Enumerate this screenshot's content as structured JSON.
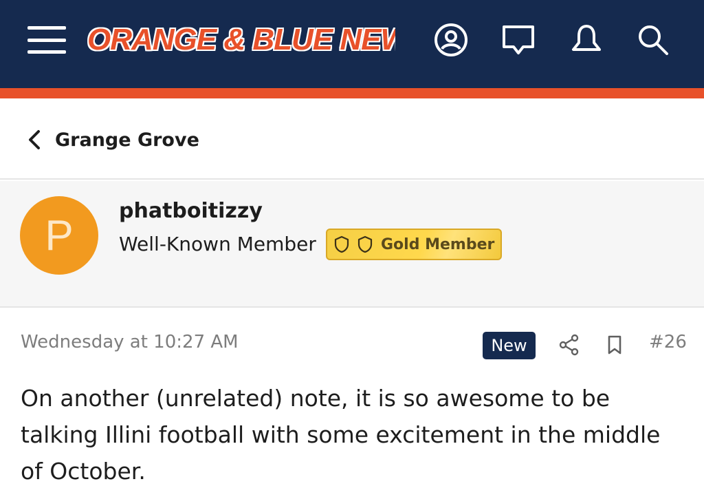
{
  "header": {
    "logo_text": "ORANGE & BLUE NEWS",
    "icons": [
      "menu-icon",
      "account-icon",
      "messages-icon",
      "alerts-icon",
      "search-icon"
    ],
    "colors": {
      "navy": "#152a4f",
      "accent": "#e8512a"
    }
  },
  "breadcrumb": {
    "label": "Grange Grove"
  },
  "author": {
    "avatar_letter": "P",
    "avatar_color": "#f29a1f",
    "username": "phatboitizzy",
    "user_title": "Well-Known Member",
    "badge_label": "Gold Member"
  },
  "post": {
    "timestamp": "Wednesday at 10:27 AM",
    "new_label": "New",
    "post_number": "#26",
    "body": "On another (unrelated) note, it is so awesome to be talking Illini football with some excitement in the middle of October."
  }
}
